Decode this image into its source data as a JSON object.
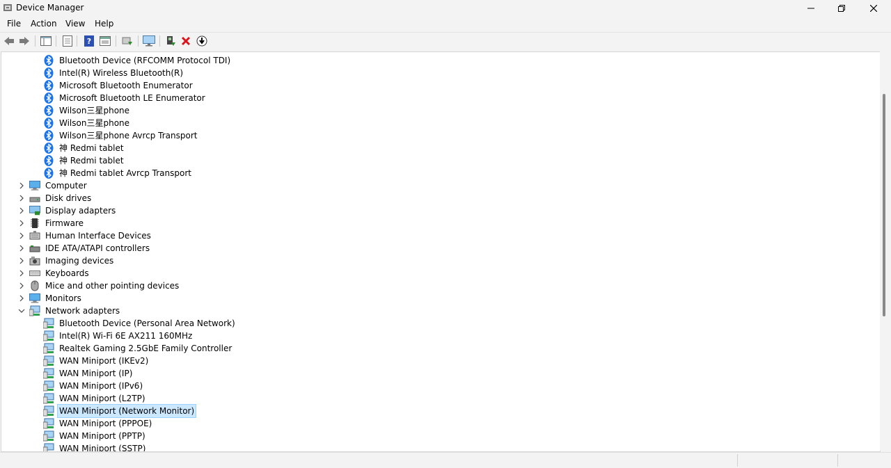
{
  "window": {
    "title": "Device Manager"
  },
  "menu": [
    "File",
    "Action",
    "View",
    "Help"
  ],
  "tree": {
    "bluetooth_children": [
      "Bluetooth Device (RFCOMM Protocol TDI)",
      "Intel(R) Wireless Bluetooth(R)",
      "Microsoft Bluetooth Enumerator",
      "Microsoft Bluetooth LE Enumerator",
      "Wilson三星phone",
      "Wilson三星phone",
      "Wilson三星phone Avrcp Transport",
      "神 Redmi tablet",
      "神 Redmi tablet",
      "神 Redmi tablet Avrcp Transport"
    ],
    "categories": [
      "Computer",
      "Disk drives",
      "Display adapters",
      "Firmware",
      "Human Interface Devices",
      "IDE ATA/ATAPI controllers",
      "Imaging devices",
      "Keyboards",
      "Mice and other pointing devices",
      "Monitors"
    ],
    "network_adapters_label": "Network adapters",
    "network_children": [
      "Bluetooth Device (Personal Area Network)",
      "Intel(R) Wi-Fi 6E AX211 160MHz",
      "Realtek Gaming 2.5GbE Family Controller",
      "WAN Miniport (IKEv2)",
      "WAN Miniport (IP)",
      "WAN Miniport (IPv6)",
      "WAN Miniport (L2TP)",
      "WAN Miniport (Network Monitor)",
      "WAN Miniport (PPPOE)",
      "WAN Miniport (PPTP)",
      "WAN Miniport (SSTP)"
    ],
    "selected_item": "WAN Miniport (Network Monitor)"
  },
  "icons": {
    "bluetooth": "bluetooth-icon",
    "network": "network-adapter-icon"
  },
  "colors": {
    "bluetooth_blue": "#1a73e8",
    "selection_bg": "#cce8ff",
    "remove_red": "#d9141b"
  }
}
